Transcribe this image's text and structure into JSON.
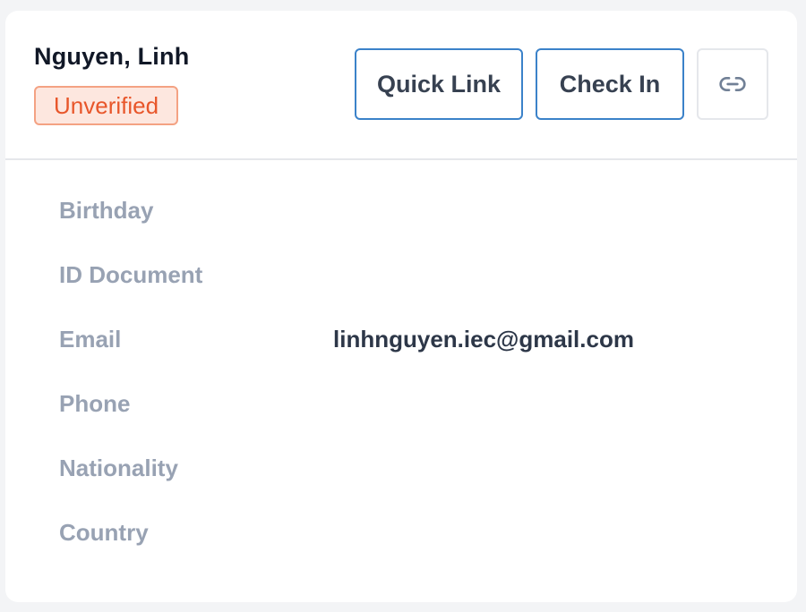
{
  "guest": {
    "name": "Nguyen, Linh",
    "status": "Unverified"
  },
  "actions": {
    "quick_link_label": "Quick Link",
    "check_in_label": "Check In",
    "copy_link_icon": "link-icon"
  },
  "fields": [
    {
      "label": "Birthday",
      "value": ""
    },
    {
      "label": "ID Document",
      "value": ""
    },
    {
      "label": "Email",
      "value": "linhnguyen.iec@gmail.com"
    },
    {
      "label": "Phone",
      "value": ""
    },
    {
      "label": "Nationality",
      "value": ""
    },
    {
      "label": "Country",
      "value": ""
    }
  ],
  "colors": {
    "accent_border": "#3b82c9",
    "status_text": "#e8562a",
    "status_bg": "#fde7df",
    "label_text": "#98a2b3"
  }
}
